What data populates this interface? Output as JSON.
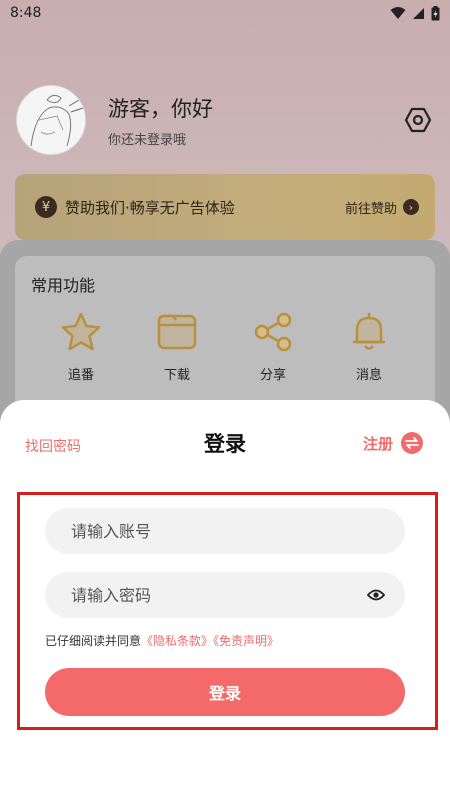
{
  "status_bar": {
    "time": "8:48"
  },
  "profile": {
    "greeting": "游客，你好",
    "subtitle": "你还未登录哦",
    "settings_icon": "hexagon-settings-icon"
  },
  "sponsor": {
    "icon_text": "¥",
    "text": "赞助我们·畅享无广告体验",
    "action": "前往赞助",
    "arrow": "›"
  },
  "common": {
    "title": "常用功能",
    "items": [
      {
        "label": "追番",
        "icon": "star-icon"
      },
      {
        "label": "下载",
        "icon": "folder-icon"
      },
      {
        "label": "分享",
        "icon": "share-icon"
      },
      {
        "label": "消息",
        "icon": "bell-icon"
      }
    ]
  },
  "login_sheet": {
    "title": "登录",
    "forgot": "找回密码",
    "register": "注册",
    "account_placeholder": "请输入账号",
    "password_placeholder": "请输入密码",
    "agreement_prefix": "已仔细阅读并同意",
    "privacy_link": "《隐私条款》",
    "disclaimer_link": "《免责声明》",
    "login_button": "登录"
  },
  "colors": {
    "accent": "#f46a6a",
    "link": "#f06b6b",
    "highlight_border": "#d91c1c",
    "sponsor_bg": "#c3ad7c"
  }
}
